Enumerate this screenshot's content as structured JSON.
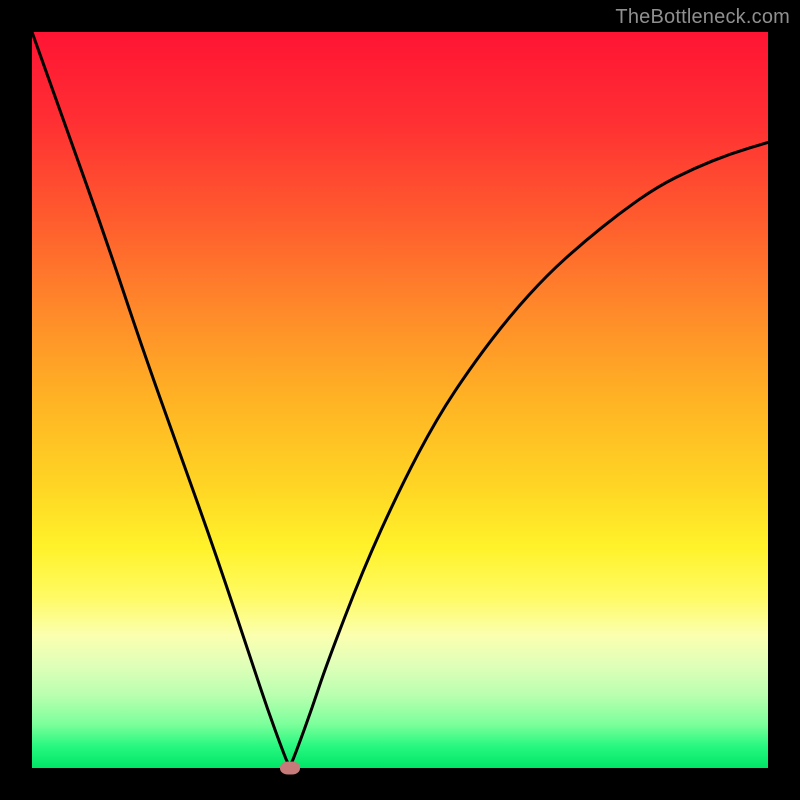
{
  "attribution": "TheBottleneck.com",
  "colors": {
    "curve": "#000000",
    "marker": "#c77a7a",
    "frame": "#000000"
  },
  "chart_data": {
    "type": "line",
    "title": "",
    "xlabel": "",
    "ylabel": "",
    "xlim": [
      0,
      100
    ],
    "ylim": [
      0,
      100
    ],
    "grid": false,
    "legend": false,
    "series": [
      {
        "name": "bottleneck-curve",
        "x": [
          0,
          5,
          10,
          15,
          20,
          25,
          30,
          32,
          34,
          35,
          36,
          38,
          40,
          45,
          50,
          55,
          60,
          65,
          70,
          75,
          80,
          85,
          90,
          95,
          100
        ],
        "y": [
          100,
          86,
          72,
          57,
          43,
          29,
          14,
          8,
          2.5,
          0,
          2.5,
          8,
          14,
          27,
          38,
          47.5,
          55,
          61.5,
          67,
          71.5,
          75.5,
          79,
          81.5,
          83.5,
          85
        ]
      }
    ],
    "annotations": [
      {
        "name": "optimal-point-marker",
        "x": 35,
        "y": 0
      }
    ]
  }
}
